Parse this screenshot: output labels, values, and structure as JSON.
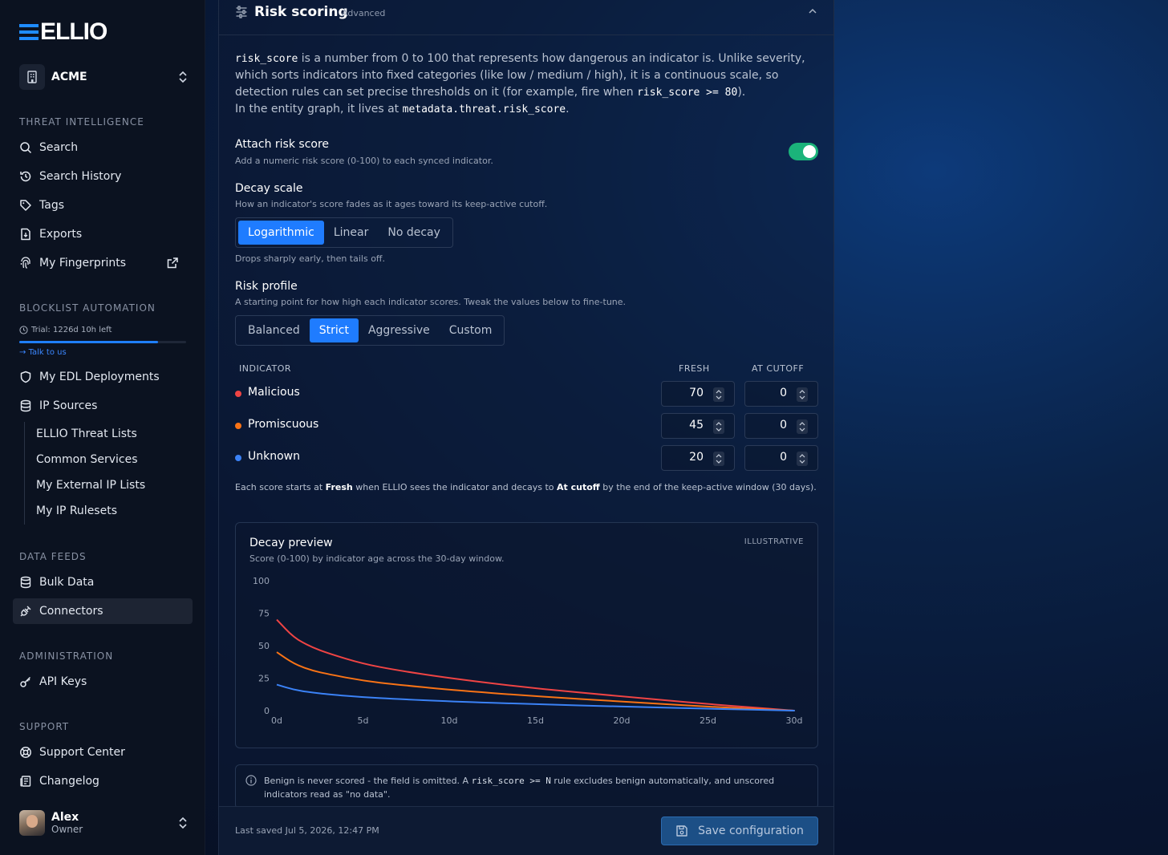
{
  "brand": {
    "logo_text": "ELLIO"
  },
  "org": {
    "name": "ACME"
  },
  "sidebar": {
    "sections": {
      "threat_intel": "THREAT INTELLIGENCE",
      "blocklist": "BLOCKLIST AUTOMATION",
      "data_feeds": "DATA FEEDS",
      "admin": "ADMINISTRATION",
      "support": "SUPPORT"
    },
    "threat_items": [
      "Search",
      "Search History",
      "Tags",
      "Exports",
      "My Fingerprints"
    ],
    "trial": {
      "text": "Trial: 1226d 10h left",
      "progress": 0.83,
      "talk": "Talk to us"
    },
    "blocklist_items": [
      "My EDL Deployments",
      "IP Sources"
    ],
    "ip_sources_sub": [
      "ELLIO Threat Lists",
      "Common Services",
      "My External IP Lists",
      "My IP Rulesets"
    ],
    "data_items": [
      "Bulk Data",
      "Connectors"
    ],
    "admin_items": [
      "API Keys"
    ],
    "support_items": [
      "Support Center",
      "Changelog"
    ]
  },
  "user": {
    "name": "Alex",
    "role": "Owner"
  },
  "panel": {
    "title": "Risk scoring",
    "badge": "Advanced",
    "desc": {
      "code1": "risk_score",
      "t1": " is a number from 0 to 100 that represents how dangerous an indicator is. Unlike severity, which sorts indicators into fixed categories (like low / medium / high), it is a continuous scale, so detection rules can set precise thresholds on it (for example, fire when ",
      "code2": "risk_score >= 80",
      "t2": ").",
      "t3": "In the entity graph, it lives at ",
      "code3": "metadata.threat.risk_score",
      "t4": "."
    },
    "attach": {
      "title": "Attach risk score",
      "sub": "Add a numeric risk score (0-100) to each synced indicator.",
      "enabled": true
    },
    "decay": {
      "title": "Decay scale",
      "sub": "How an indicator's score fades as it ages toward its keep-active cutoff.",
      "options": [
        "Logarithmic",
        "Linear",
        "No decay"
      ],
      "selected": "Logarithmic",
      "hint": "Drops sharply early, then tails off."
    },
    "profile": {
      "title": "Risk profile",
      "sub": "A starting point for how high each indicator scores. Tweak the values below to fine-tune.",
      "options": [
        "Balanced",
        "Strict",
        "Aggressive",
        "Custom"
      ],
      "selected": "Strict"
    },
    "table": {
      "headers": {
        "indicator": "INDICATOR",
        "fresh": "FRESH",
        "cutoff": "AT CUTOFF"
      },
      "rows": [
        {
          "name": "Malicious",
          "color": "#ef4444",
          "fresh": "70",
          "cutoff": "0"
        },
        {
          "name": "Promiscuous",
          "color": "#f97316",
          "fresh": "45",
          "cutoff": "0"
        },
        {
          "name": "Unknown",
          "color": "#3b82f6",
          "fresh": "20",
          "cutoff": "0"
        }
      ]
    },
    "note": {
      "t1": "Each score starts at ",
      "b1": "Fresh",
      "t2": " when ELLIO sees the indicator and decays to ",
      "b2": "At cutoff",
      "t3": " by the end of the keep-active window (30 days)."
    },
    "preview": {
      "title": "Decay preview",
      "sub": "Score (0-100) by indicator age across the 30-day window.",
      "tag": "ILLUSTRATIVE"
    },
    "info": {
      "t1": "Benign is never scored - the field is omitted. A ",
      "code": "risk_score >= N",
      "t2": " rule excludes benign automatically, and unscored indicators read as \"no data\"."
    },
    "footer": {
      "saved": "Last saved Jul 5, 2026, 12:47 PM",
      "save_label": "Save configuration"
    }
  },
  "chart_data": {
    "type": "line",
    "title": "Decay preview",
    "subtitle": "Score (0-100) by indicator age across the 30-day window.",
    "x_ticks": [
      "0d",
      "5d",
      "10d",
      "15d",
      "20d",
      "25d",
      "30d"
    ],
    "y_ticks": [
      "0",
      "25",
      "50",
      "75",
      "100"
    ],
    "ylim": [
      0,
      100
    ],
    "xlim": [
      0,
      30
    ],
    "grid": false,
    "series": [
      {
        "color": "#ef4444",
        "x": [
          0,
          1,
          2,
          3,
          5,
          7,
          10,
          15,
          20,
          25,
          30
        ],
        "y": [
          70,
          56,
          49,
          44,
          36,
          31,
          25,
          17,
          11,
          5,
          0
        ]
      },
      {
        "color": "#f97316",
        "x": [
          0,
          1,
          2,
          3,
          5,
          7,
          10,
          15,
          20,
          25,
          30
        ],
        "y": [
          45,
          36,
          31,
          28,
          23,
          20,
          16,
          11,
          7,
          3,
          0
        ]
      },
      {
        "color": "#3b82f6",
        "x": [
          0,
          1,
          2,
          3,
          5,
          7,
          10,
          15,
          20,
          25,
          30
        ],
        "y": [
          20,
          16,
          14,
          12.5,
          10.3,
          8.9,
          7.1,
          4.9,
          3.1,
          1.5,
          0
        ]
      }
    ]
  }
}
